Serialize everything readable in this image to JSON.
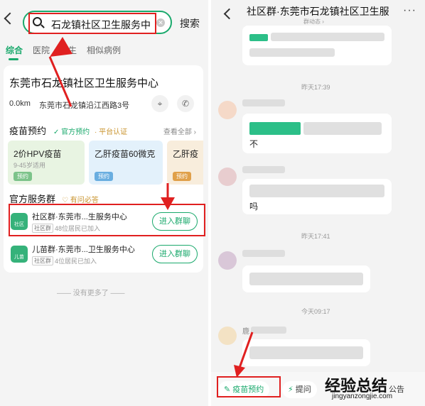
{
  "left": {
    "search_value": "石龙镇社区卫生服务中心",
    "search_button": "搜索",
    "tabs": [
      "综合",
      "医院",
      "医生",
      "相似病例"
    ],
    "org": {
      "name": "东莞市石龙镇社区卫生服务中心",
      "distance": "0.0km",
      "address": "东莞市石龙镇沿江西路3号"
    },
    "vaccine": {
      "title": "疫苗预约",
      "badge_official": "官方预约",
      "badge_platform": "平台认证",
      "see_all": "查看全部",
      "cards": [
        {
          "name": "2价HPV疫苗",
          "sub": "9-45岁适用",
          "pill": "预约"
        },
        {
          "name": "乙肝疫苗60微克",
          "sub": "",
          "pill": "预约"
        },
        {
          "name": "乙肝疫",
          "sub": "",
          "pill": "预约"
        }
      ]
    },
    "groups": {
      "title": "官方服务群",
      "badge": "有问必答",
      "items": [
        {
          "avatar": "社区",
          "name": "社区群·东莞市...生服务中心",
          "tag": "社区群",
          "members": "48位居民已加入",
          "button": "进入群聊"
        },
        {
          "avatar": "儿苗",
          "name": "儿苗群·东莞市...卫生服务中心",
          "tag": "社区群",
          "members": "4位居民已加入",
          "button": "进入群聊"
        }
      ]
    },
    "no_more": "没有更多了"
  },
  "right": {
    "title": "社区群·东莞市石龙镇社区卫生服...",
    "subtitle": "群动态",
    "times": [
      "昨天17:39",
      "昨天17:41",
      "今天09:17"
    ],
    "visible_char_1": "不",
    "visible_char_2": "吗",
    "sender_prefix": "鹿",
    "shortcuts": {
      "vaccine": "疫苗预约",
      "ask": "提问",
      "notice": "公告"
    },
    "watermark": "经验总结",
    "watermark_url": "jingyanzongjie.com"
  },
  "colors": {
    "accent": "#1aa96c",
    "highlight": "#e02020"
  }
}
